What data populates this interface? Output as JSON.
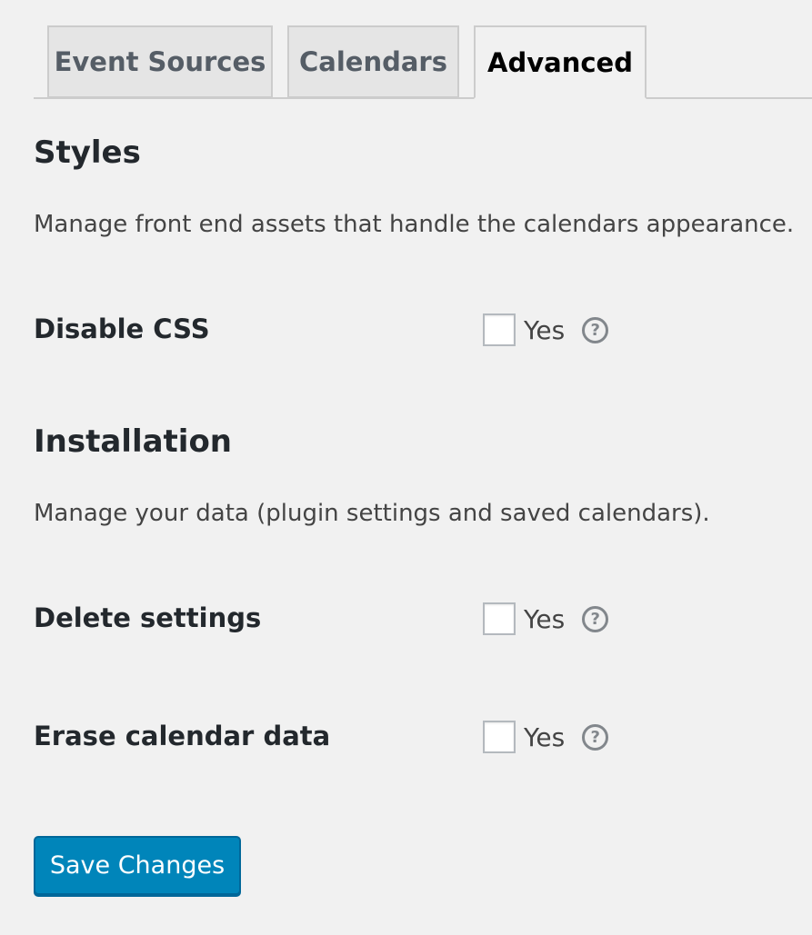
{
  "tabs": [
    {
      "label": "Event Sources",
      "active": false
    },
    {
      "label": "Calendars",
      "active": false
    },
    {
      "label": "Advanced",
      "active": true
    }
  ],
  "styles_section": {
    "title": "Styles",
    "description": "Manage front end assets that handle the calendars appearance.",
    "rows": [
      {
        "label": "Disable CSS",
        "checked": false,
        "option": "Yes",
        "help_icon": "question-circle-icon"
      }
    ]
  },
  "installation_section": {
    "title": "Installation",
    "description": "Manage your data (plugin settings and saved calendars).",
    "rows": [
      {
        "label": "Delete settings",
        "checked": false,
        "option": "Yes",
        "help_icon": "question-circle-icon"
      },
      {
        "label": "Erase calendar data",
        "checked": false,
        "option": "Yes",
        "help_icon": "question-circle-icon"
      }
    ]
  },
  "save_button": {
    "label": "Save Changes"
  },
  "colors": {
    "background": "#f1f1f1",
    "primary_button": "#0085ba",
    "tab_inactive": "#e5e5e5"
  }
}
